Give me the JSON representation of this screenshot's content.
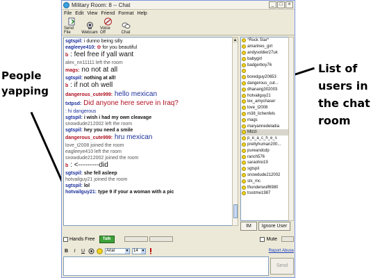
{
  "window": {
    "title": "Military Room: 8 -- Chat",
    "controls": [
      "_",
      "□",
      "×"
    ]
  },
  "menu": [
    "File",
    "Edit",
    "View",
    "Friend",
    "Format",
    "Help"
  ],
  "toolbar": [
    {
      "label": "Send File",
      "icon": "send-file-icon"
    },
    {
      "label": "Webcam",
      "icon": "webcam-icon"
    },
    {
      "label": "Voice Off",
      "icon": "voice-off-icon"
    },
    {
      "label": "Chat",
      "icon": "chat-bubble-icon"
    }
  ],
  "messages": [
    {
      "nick": "sgtspil:",
      "text": "i dunno being silly",
      "nickColor": "blue",
      "size": "small"
    },
    {
      "nick": "eagleeye410:",
      "text": "for you beautiful",
      "nickColor": "blue",
      "size": "small",
      "icon": "rose"
    },
    {
      "nick": "b",
      "text": ": feel free if yall want",
      "nickColor": "red",
      "size": "big"
    },
    {
      "nick": "",
      "text": "alex_nn11111 left the room",
      "nickColor": "sys",
      "size": "small"
    },
    {
      "nick": "mags:",
      "text": "no not at all",
      "nickColor": "red",
      "size": "big"
    },
    {
      "nick": "sgtspil:",
      "text": "nothing at all!",
      "nickColor": "blue",
      "size": "small",
      "bold": true
    },
    {
      "nick": "b",
      "text": ": if not oh well",
      "nickColor": "red",
      "size": "big"
    },
    {
      "nick": "dangerous_cute999:",
      "text": "hello mexican",
      "nickColor": "red",
      "size": "big",
      "textColor": "blue"
    },
    {
      "nick": "txtpsd:",
      "text": "Did anyone here serve in Iraq?",
      "nickColor": "blue",
      "size": "big",
      "textColor": "red"
    },
    {
      "nick": "",
      "text": ": hi dangerous",
      "nickColor": "blue",
      "size": "small",
      "textColor": "blue"
    },
    {
      "nick": "sgtspil:",
      "text": "i wish i had my own cleavage",
      "nickColor": "blue",
      "size": "small",
      "bold": true
    },
    {
      "nick": "",
      "text": "snowdude212002 left the room",
      "nickColor": "sys",
      "size": "small"
    },
    {
      "nick": "sgtspil:",
      "text": "hey you need a smile",
      "nickColor": "blue",
      "size": "small",
      "bold": true
    },
    {
      "nick": "dangerous_cute999:",
      "text": "hru mexican",
      "nickColor": "red",
      "size": "big",
      "textColor": "blue"
    },
    {
      "nick": "",
      "text": "love_t2008 joined the room",
      "nickColor": "sys",
      "size": "small"
    },
    {
      "nick": "",
      "text": "eagleeye410 left the room",
      "nickColor": "sys",
      "size": "small"
    },
    {
      "nick": "",
      "text": "snowdude212002 joined the room",
      "nickColor": "sys",
      "size": "small"
    },
    {
      "nick": "b",
      "text": ": <---------did",
      "nickColor": "red",
      "size": "big"
    },
    {
      "nick": "sgtspil:",
      "text": "she fell asleep",
      "nickColor": "blue",
      "size": "small",
      "bold": true
    },
    {
      "nick": "",
      "text": "hotvailguy21 joined the room",
      "nickColor": "sys",
      "size": "small"
    },
    {
      "nick": "sgtspil:",
      "text": "lol",
      "nickColor": "blue",
      "size": "small",
      "bold": true
    },
    {
      "nick": "hotvailguy21:",
      "text": "type 9 if your a woman with a pic",
      "nickColor": "blue",
      "size": "small",
      "bold": true
    }
  ],
  "users": [
    "*Rock Star*",
    "amarines_girl",
    "andysoldier27uk",
    "babygirl",
    "badgerboy76",
    "",
    "boredguy20653",
    "dangerous_cut...",
    "dhanang302003",
    "hotvailguy21",
    "lex_amychaser",
    "love_t2008",
    "m38_lichenfels",
    "mags",
    "maryannedeladia",
    "Mizzi",
    "p_e_a_c_h_e_s",
    "prettyhuman200...",
    "pureandcdp",
    "ranch576",
    "saraohio19",
    "sgtspil",
    "snowdude212002",
    "stx_mc",
    "thunderwulf6980",
    "trustme1987"
  ],
  "selected_user": "Mizzi",
  "user_buttons": {
    "im": "IM",
    "ignore": "Ignore User"
  },
  "voice": {
    "hands_free": "Hands Free",
    "talk": "Talk",
    "mute": "Mute"
  },
  "format": {
    "bold": "B",
    "italic": "I",
    "underline": "U",
    "font": "Arial",
    "size": "14"
  },
  "report_abuse": "Report Abuse",
  "send": "Send",
  "annotations": {
    "people": "People yapping",
    "users": "List of users in the chat room"
  }
}
